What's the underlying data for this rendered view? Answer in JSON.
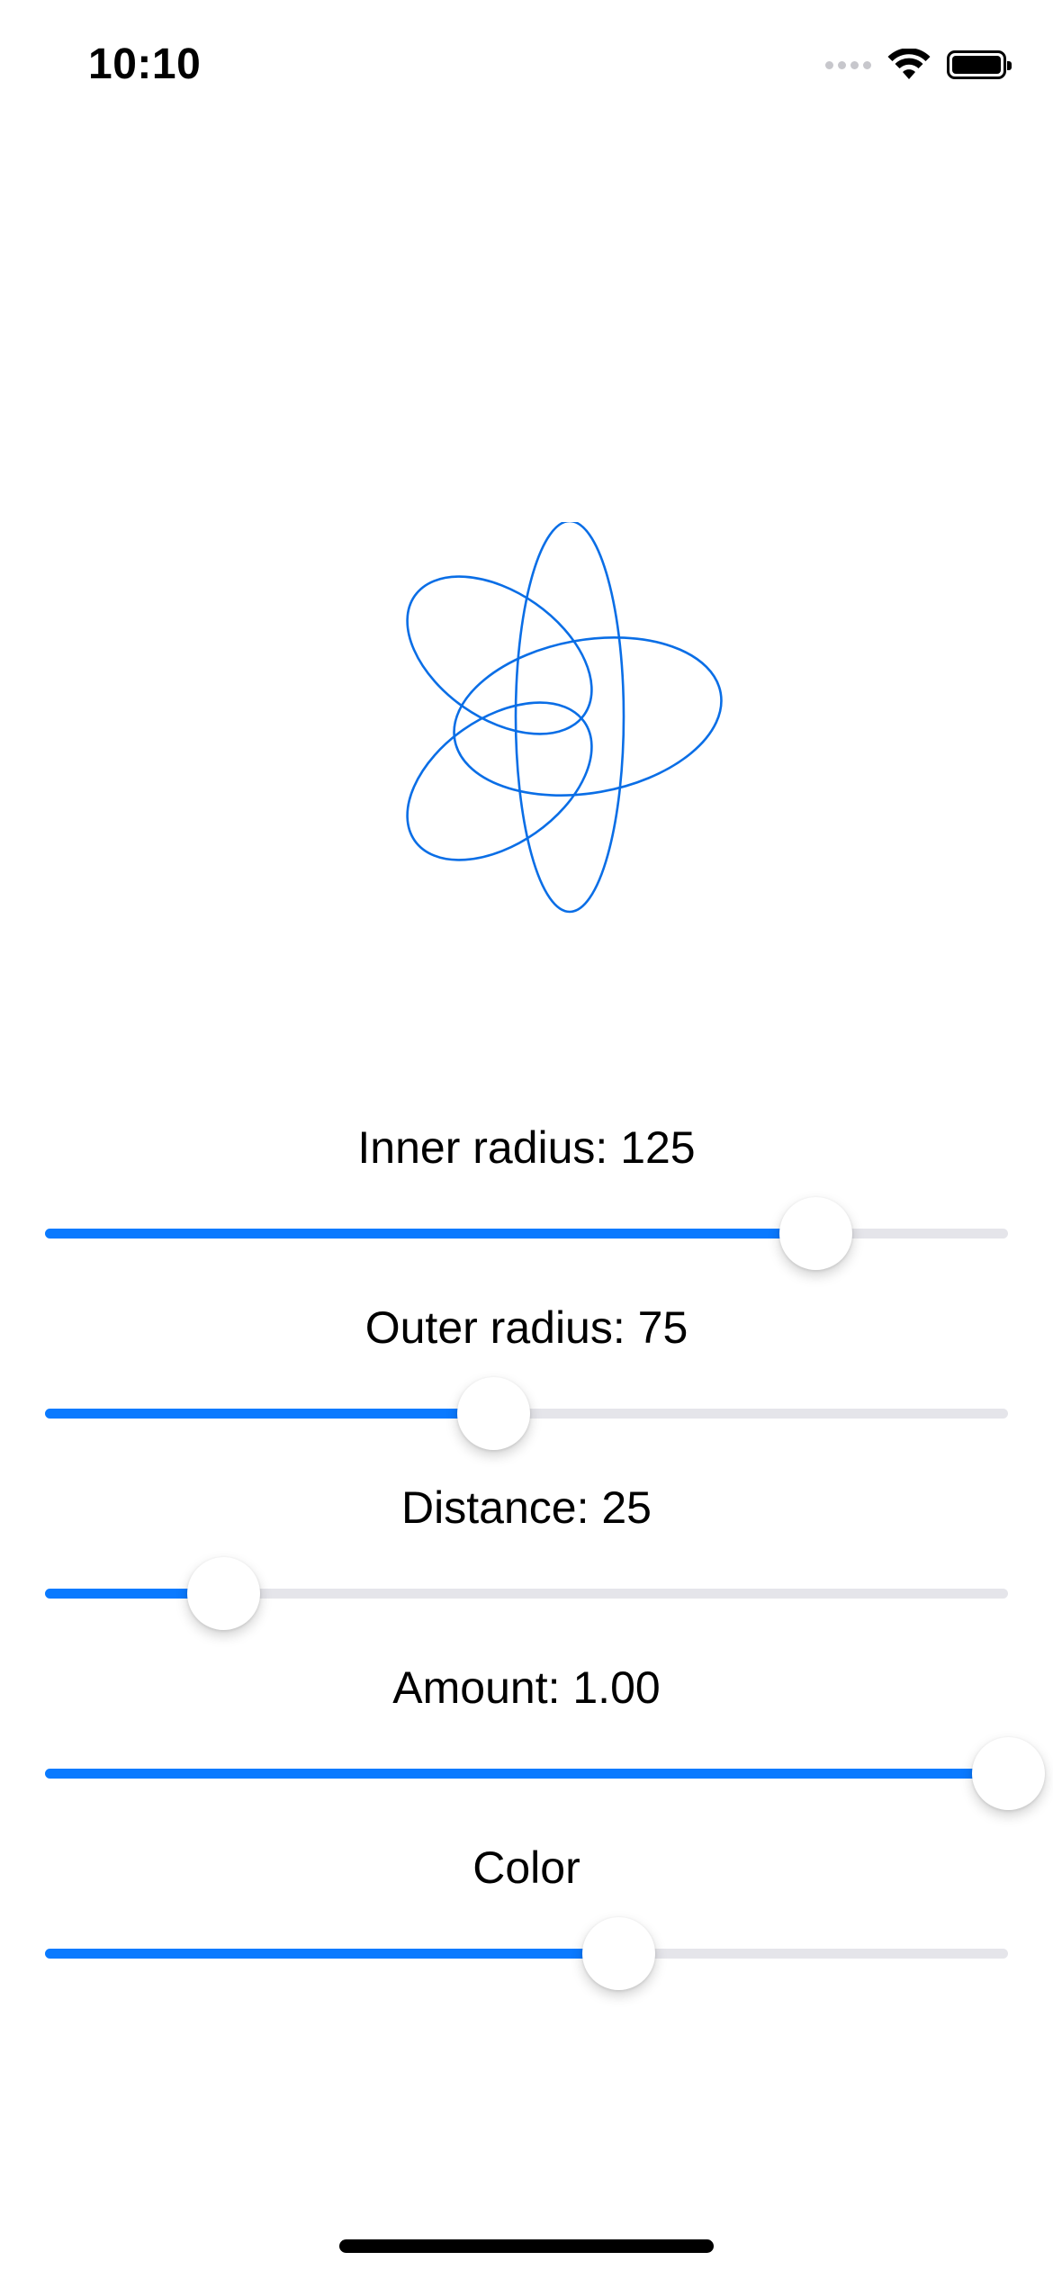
{
  "status_bar": {
    "time": "10:10",
    "icons": [
      "cellular-signal-icon",
      "wifi-icon",
      "battery-icon"
    ]
  },
  "drawing": {
    "shape": "flower-icon",
    "stroke_color": "#0a6ee6"
  },
  "controls": [
    {
      "key": "inner_radius",
      "label": "Inner radius: 125",
      "value_fraction": 0.8
    },
    {
      "key": "outer_radius",
      "label": "Outer radius: 75",
      "value_fraction": 0.465
    },
    {
      "key": "distance",
      "label": "Distance: 25",
      "value_fraction": 0.185
    },
    {
      "key": "amount",
      "label": "Amount: 1.00",
      "value_fraction": 1.0
    },
    {
      "key": "color",
      "label": "Color",
      "value_fraction": 0.595
    }
  ],
  "colors": {
    "accent": "#0a7aff",
    "track": "#e5e5ea"
  }
}
